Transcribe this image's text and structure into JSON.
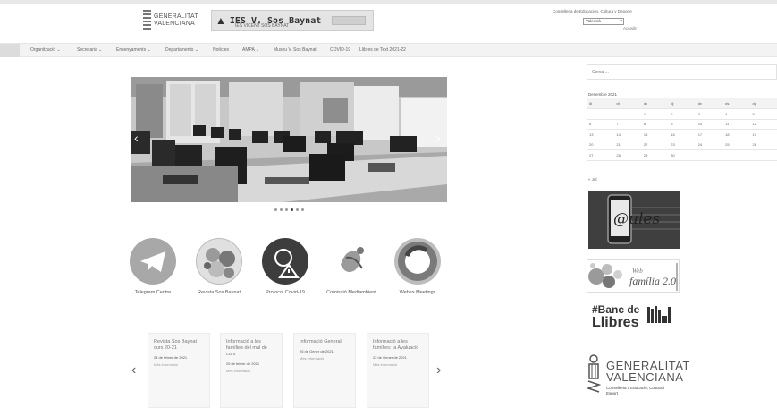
{
  "header": {
    "gva_logo_line1": "GENERALITAT",
    "gva_logo_line2": "VALENCIANA",
    "school_banner": "IES V. Sos Baynat",
    "school_banner_sub": "IES VICENT SOS BAYNAT",
    "conselleria": "Conselleria de Educación, Cultura y Deporte",
    "language_select": "Valencià",
    "login_link": "Accedir"
  },
  "nav": {
    "items": [
      "Organització",
      "Secretaria",
      "Ensenyaments",
      "Departaments",
      "Notícies",
      "AMPA",
      "Museu V. Sos Baynat",
      "COVID-19",
      "Llibres de Text 2021-22"
    ]
  },
  "slider": {
    "dots": 6,
    "active_dot": 4
  },
  "circles": [
    {
      "label": "Telegram Centre",
      "icon": "telegram-icon"
    },
    {
      "label": "Revista Sos Baynat",
      "icon": "magazine-icon"
    },
    {
      "label": "Protocol Covid-19",
      "icon": "virus-warning-icon"
    },
    {
      "label": "Comissió Mediambient",
      "icon": "environment-icon"
    },
    {
      "label": "Webex Meetings",
      "icon": "webex-icon"
    }
  ],
  "news": [
    {
      "title": "Revista Sos Baynat curs 20-21",
      "date": "24 de febrer de 2021",
      "more": "Més informació"
    },
    {
      "title": "Informació a les famílies del mal de curs",
      "date": "25 de febrer de 2021",
      "more": "Més informació"
    },
    {
      "title": "Informació General",
      "date": "26 de Gener de 2021",
      "more": "Més informació"
    },
    {
      "title": "Informació a les famílies: la Avaluació",
      "date": "22 de Gener de 2021",
      "more": "Més informació"
    }
  ],
  "sidebar": {
    "search_placeholder": "Cerca ...",
    "calendar": {
      "caption": "Desembre 2021",
      "headers": [
        "dl",
        "dt",
        "dc",
        "dj",
        "dv",
        "ds",
        "dg"
      ],
      "rows": [
        [
          "",
          "",
          "1",
          "2",
          "3",
          "4",
          "5"
        ],
        [
          "6",
          "7",
          "8",
          "9",
          "10",
          "11",
          "12"
        ],
        [
          "13",
          "14",
          "15",
          "16",
          "17",
          "18",
          "19"
        ],
        [
          "20",
          "21",
          "22",
          "23",
          "24",
          "25",
          "26"
        ],
        [
          "27",
          "28",
          "29",
          "30",
          "",
          "",
          ""
        ]
      ],
      "prev_link": "« Jul"
    },
    "aules_logo": "@ules",
    "familia_logo_small": "Web",
    "familia_logo": "família 2.0",
    "banc_line1": "#Banc de",
    "banc_line2": "Llibres",
    "gva_name_line1": "GENERALITAT",
    "gva_name_line2": "VALENCIANA",
    "gva_sub": "Conselleria d'Educació, Cultura i Esport"
  },
  "colors": {
    "nav_bg": "#f3f3f3",
    "aules_bg": "#3f3f3f",
    "circle_dark": "#3d3d3d",
    "circle_grey": "#a8a8a8"
  }
}
